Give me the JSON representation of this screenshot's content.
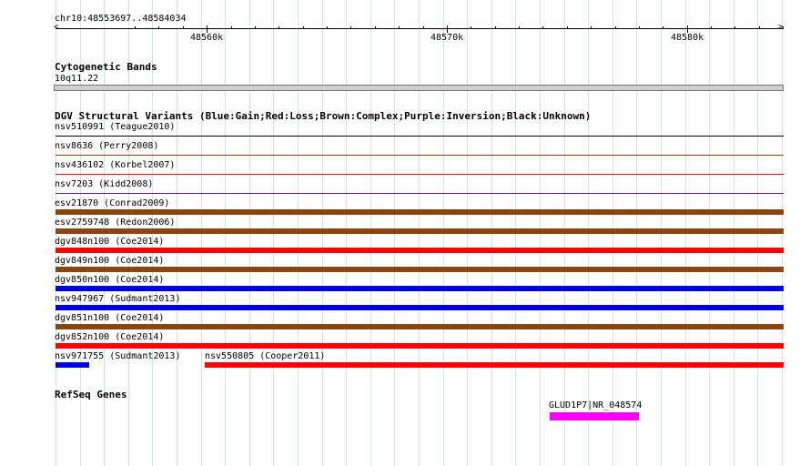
{
  "locus": "chr10:48553697..48584034",
  "ruler": {
    "ticks": [
      {
        "label": "48560k",
        "position": 48560000
      },
      {
        "label": "48570k",
        "position": 48570000
      },
      {
        "label": "48580k",
        "position": 48580000
      }
    ]
  },
  "view": {
    "start": 48553697,
    "end": 48584034
  },
  "tracks": {
    "cytoband": {
      "title": "Cytogenetic Bands",
      "band": "10q11.22",
      "color": "#cfcfcf"
    },
    "dgv": {
      "title": "DGV Structural Variants (Blue:Gain;Red:Loss;Brown:Complex;Purple:Inversion;Black:Unknown)",
      "colors": {
        "Gain": "#0000e0",
        "Loss": "#ff0000",
        "Complex": "#8b4513",
        "Inversion": "#551a8b",
        "Unknown": "#000000"
      },
      "features": [
        {
          "label": "nsv510991 (Teague2010)",
          "type": "Unknown",
          "weight": "thin"
        },
        {
          "label": "nsv8636 (Perry2008)",
          "type": "Complex",
          "weight": "thin"
        },
        {
          "label": "nsv436102 (Korbel2007)",
          "type": "Loss",
          "weight": "thin"
        },
        {
          "label": "nsv7203 (Kidd2008)",
          "type": "Inversion",
          "weight": "thin"
        },
        {
          "label": "esv21870 (Conrad2009)",
          "type": "Complex",
          "weight": "thick"
        },
        {
          "label": "esv2759748 (Redon2006)",
          "type": "Complex",
          "weight": "thick"
        },
        {
          "label": "dgv848n100 (Coe2014)",
          "type": "Loss",
          "weight": "thick"
        },
        {
          "label": "dgv849n100 (Coe2014)",
          "type": "Complex",
          "weight": "thick"
        },
        {
          "label": "dgv850n100 (Coe2014)",
          "type": "Gain",
          "weight": "thick"
        },
        {
          "label": "nsv947967 (Sudmant2013)",
          "type": "Gain",
          "weight": "thick"
        },
        {
          "label": "dgv851n100 (Coe2014)",
          "type": "Complex",
          "weight": "thick"
        },
        {
          "label": "dgv852n100 (Coe2014)",
          "type": "Loss",
          "weight": "thick"
        }
      ],
      "last_row": [
        {
          "label": "nsv971755 (Sudmant2013)",
          "type": "Gain",
          "start": 48553697,
          "end": 48555100
        },
        {
          "label": "nsv550805 (Cooper2011)",
          "type": "Loss",
          "start": 48559900,
          "end": 48584034
        }
      ]
    },
    "refseq": {
      "title": "RefSeq Genes",
      "gene": {
        "label": "GLUD1P7|NR_048574",
        "start": 48574300,
        "end": 48578000,
        "color": "#ff00ff"
      }
    }
  }
}
